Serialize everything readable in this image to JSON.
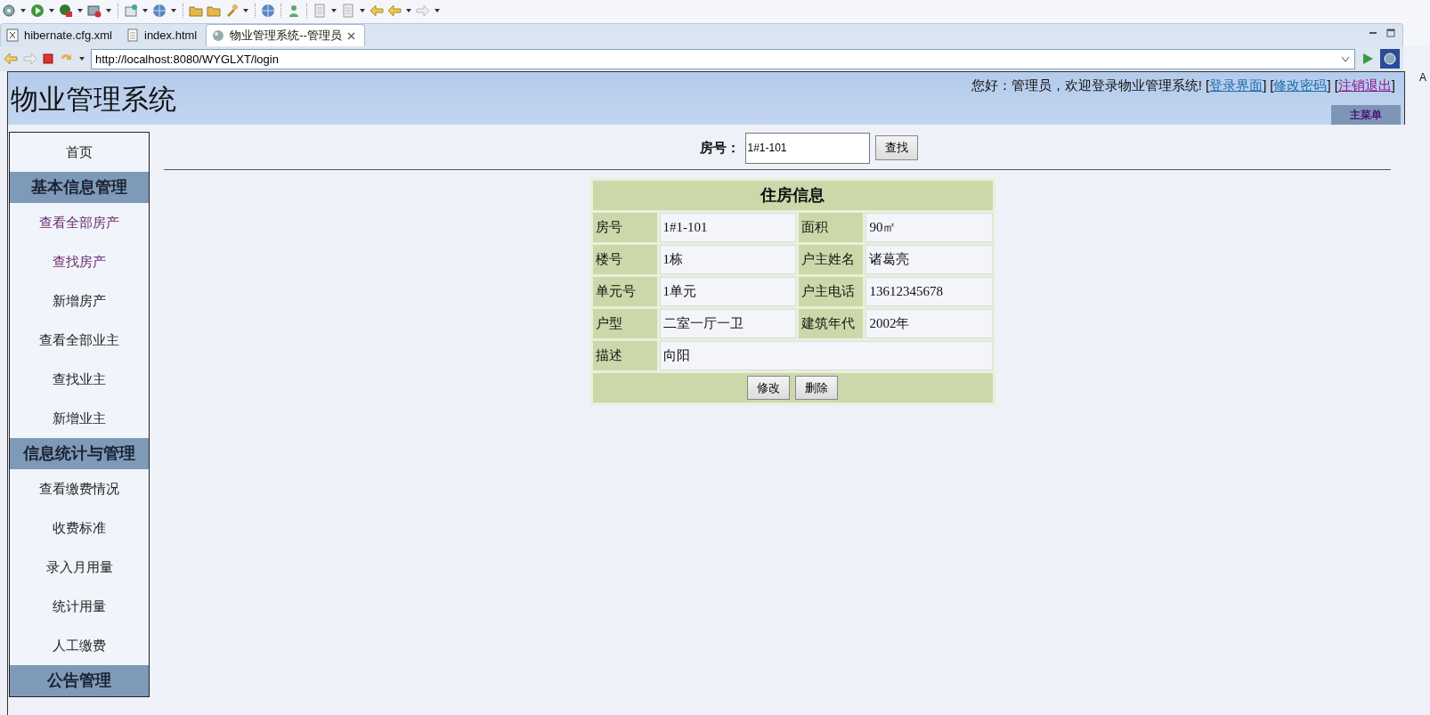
{
  "editor_tabs": [
    {
      "label": "hibernate.cfg.xml",
      "kind": "xml",
      "selected": false
    },
    {
      "label": "index.html",
      "kind": "html",
      "selected": false
    },
    {
      "label": "物业管理系统--管理员",
      "kind": "web",
      "selected": true
    }
  ],
  "address_bar": {
    "url": "http://localhost:8080/WYGLXT/login"
  },
  "side_text": "A",
  "header": {
    "title": "物业管理系统",
    "greeting": "您好：管理员，欢迎登录物业管理系统!",
    "links": [
      {
        "before": "[",
        "label": "登录界面",
        "after": "]",
        "visited": false
      },
      {
        "before": "[",
        "label": "修改密码",
        "after": "]",
        "visited": false
      },
      {
        "before": "[",
        "label": "注销退出",
        "after": "]",
        "visited": true
      }
    ],
    "menu_button": "主菜单"
  },
  "sidebar": {
    "items": [
      {
        "kind": "link",
        "label": "首页",
        "visited": false
      },
      {
        "kind": "header",
        "label": "基本信息管理"
      },
      {
        "kind": "link",
        "label": "查看全部房产",
        "visited": true
      },
      {
        "kind": "link",
        "label": "查找房产",
        "visited": true
      },
      {
        "kind": "link",
        "label": "新增房产",
        "visited": false
      },
      {
        "kind": "link",
        "label": "查看全部业主",
        "visited": false
      },
      {
        "kind": "link",
        "label": "查找业主",
        "visited": false
      },
      {
        "kind": "link",
        "label": "新增业主",
        "visited": false
      },
      {
        "kind": "header",
        "label": "信息统计与管理"
      },
      {
        "kind": "link",
        "label": "查看缴费情况",
        "visited": false
      },
      {
        "kind": "link",
        "label": "收费标准",
        "visited": false
      },
      {
        "kind": "link",
        "label": "录入月用量",
        "visited": false
      },
      {
        "kind": "link",
        "label": "统计用量",
        "visited": false
      },
      {
        "kind": "link",
        "label": "人工缴费",
        "visited": false
      },
      {
        "kind": "header",
        "label": "公告管理"
      }
    ]
  },
  "search": {
    "label": "房号：",
    "value": "1#1-101",
    "button": "查找"
  },
  "house_table": {
    "title": "住房信息",
    "rows": [
      [
        {
          "label": "房号",
          "value": "1#1-101"
        },
        {
          "label": "面积",
          "value": "90㎡"
        }
      ],
      [
        {
          "label": "楼号",
          "value": "1栋"
        },
        {
          "label": "户主姓名",
          "value": "诸葛亮"
        }
      ],
      [
        {
          "label": "单元号",
          "value": "1单元"
        },
        {
          "label": "户主电话",
          "value": "13612345678"
        }
      ],
      [
        {
          "label": "户型",
          "value": "二室一厅一卫"
        },
        {
          "label": "建筑年代",
          "value": "2002年"
        }
      ],
      [
        {
          "label": "描述",
          "value": "向阳"
        }
      ]
    ],
    "buttons": [
      "修改",
      "删除"
    ]
  }
}
